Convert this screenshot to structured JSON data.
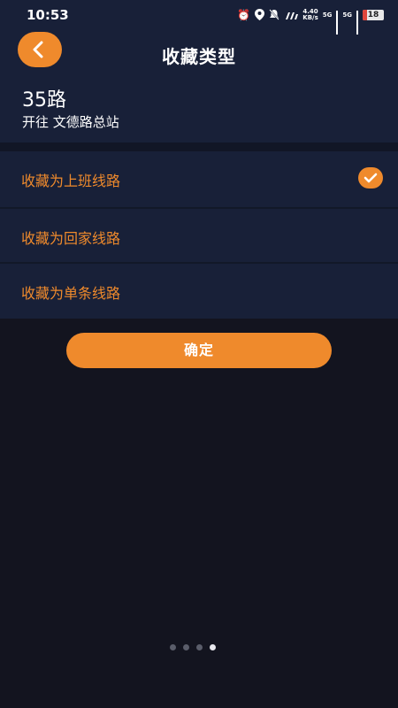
{
  "status_bar": {
    "time": "10:53",
    "speed_value": "4.40",
    "speed_unit": "KB/s",
    "network_1": "5G",
    "network_2": "5G",
    "battery": "18"
  },
  "header": {
    "title": "收藏类型",
    "back_icon": "chevron-left-icon"
  },
  "route": {
    "name": "35路",
    "direction": "开往 文德路总站"
  },
  "options": [
    {
      "label": "收藏为上班线路",
      "selected": true
    },
    {
      "label": "收藏为回家线路",
      "selected": false
    },
    {
      "label": "收藏为单条线路",
      "selected": false
    }
  ],
  "confirm_label": "确定",
  "pager": {
    "count": 4,
    "active_index": 3
  },
  "colors": {
    "accent": "#ef8a2c",
    "panel": "#182038",
    "background": "#13141f"
  }
}
